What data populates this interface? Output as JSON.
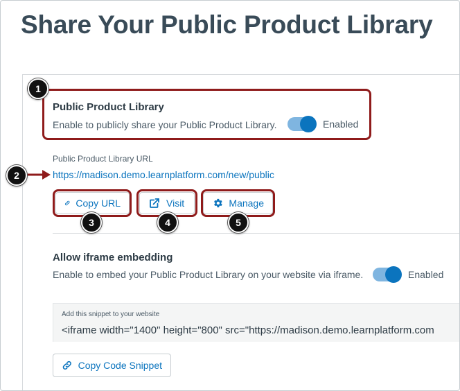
{
  "page": {
    "title": "Share Your Public Product Library"
  },
  "library": {
    "heading": "Public Product Library",
    "description": "Enable to publicly share your Public Product Library.",
    "toggle_label": "Enabled",
    "enabled": true
  },
  "url_field": {
    "label": "Public Product Library URL",
    "value": "https://madison.demo.learnplatform.com/new/public"
  },
  "actions": {
    "copy_url": "Copy URL",
    "visit": "Visit",
    "manage": "Manage"
  },
  "iframe": {
    "heading": "Allow iframe embedding",
    "description": "Enable to embed your Public Product Library on your website via iframe.",
    "toggle_label": "Enabled",
    "enabled": true,
    "snippet_label": "Add this snippet to your website",
    "snippet_code": "<iframe width=\"1400\" height=\"800\" src=\"https://madison.demo.learnplatform.com",
    "copy_snippet": "Copy Code Snippet"
  },
  "callouts": [
    "1",
    "2",
    "3",
    "4",
    "5"
  ],
  "colors": {
    "link": "#0b74be",
    "highlight": "#8f1b1b",
    "toggle_on": "#0b74be",
    "title": "#394b58"
  },
  "icons": {
    "copy_url": "link-icon",
    "visit": "external-link-icon",
    "manage": "gear-icon",
    "copy_snippet": "link-icon"
  }
}
